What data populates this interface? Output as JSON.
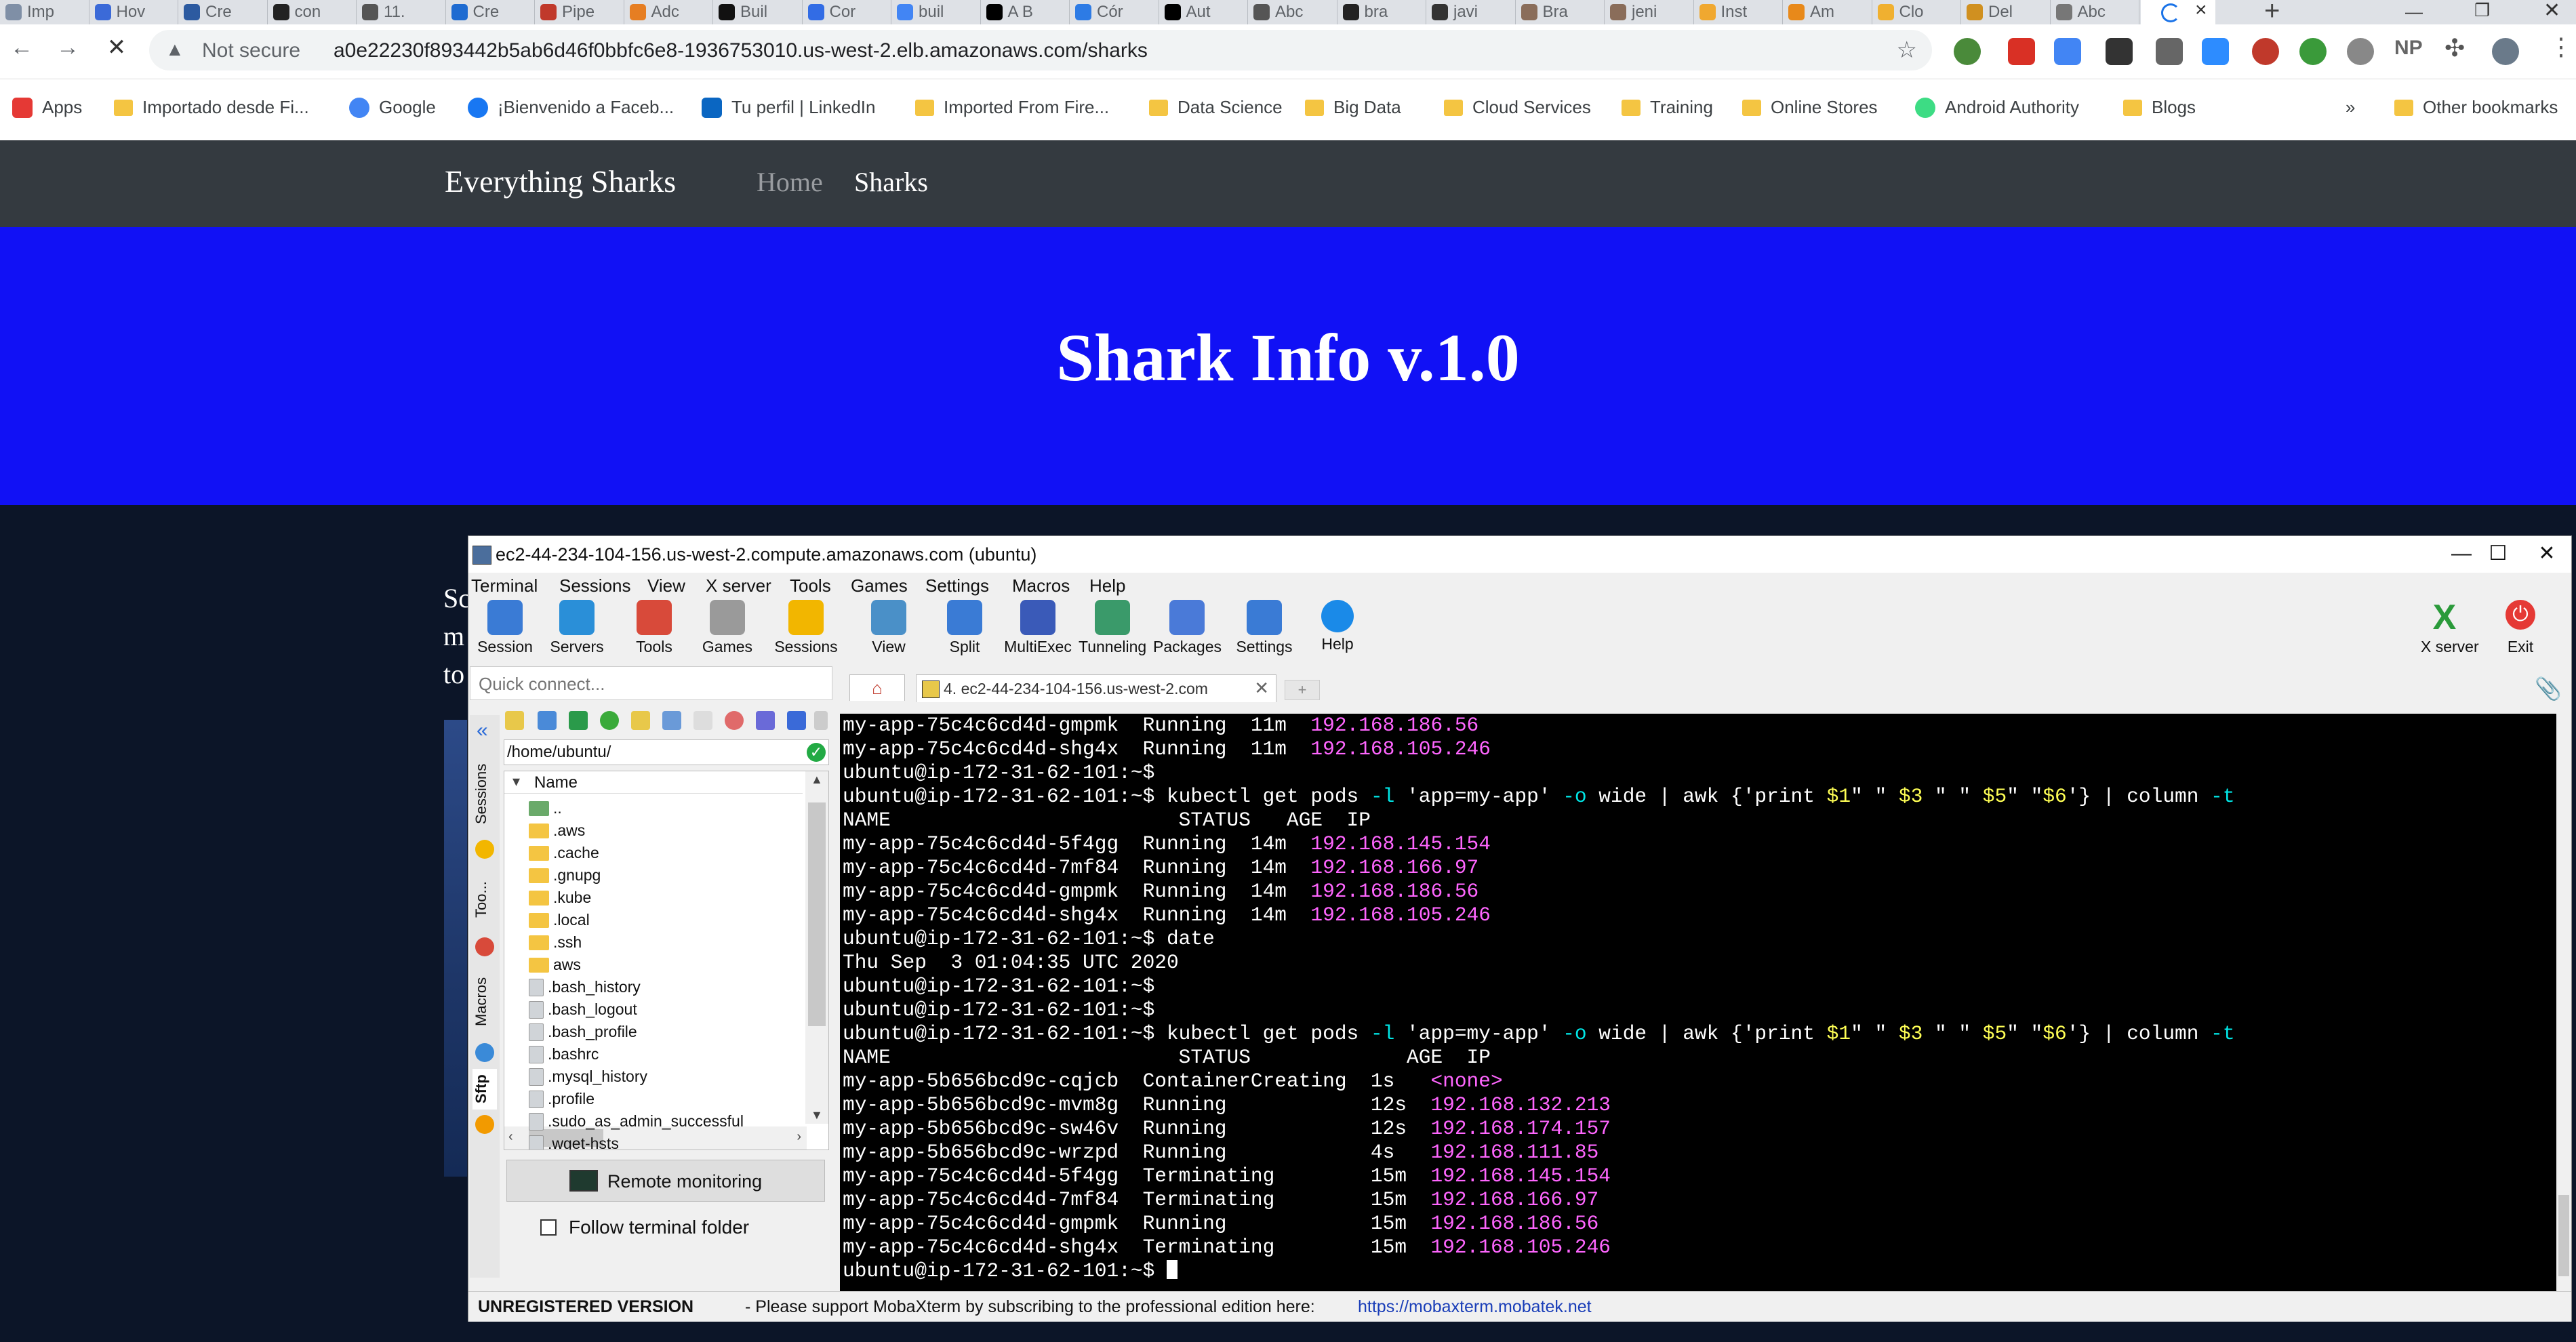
{
  "browser": {
    "tabs": [
      {
        "label": "Imp",
        "color": "#7f8fa6"
      },
      {
        "label": "Hov",
        "color": "#3b6ad8"
      },
      {
        "label": "Cre",
        "color": "#2c5aa0"
      },
      {
        "label": "con",
        "color": "#222222"
      },
      {
        "label": "11.",
        "color": "#555555"
      },
      {
        "label": "Cre",
        "color": "#1e6bd1"
      },
      {
        "label": "Pipe",
        "color": "#c0392b"
      },
      {
        "label": "Adc",
        "color": "#e67e22"
      },
      {
        "label": "Buil",
        "color": "#111111"
      },
      {
        "label": "Cor",
        "color": "#326ce5"
      },
      {
        "label": "buil",
        "color": "#4285f4"
      },
      {
        "label": "A B",
        "color": "#000000"
      },
      {
        "label": "Cór",
        "color": "#2d7be5"
      },
      {
        "label": "Aut",
        "color": "#000000"
      },
      {
        "label": "Abc",
        "color": "#555555"
      },
      {
        "label": "bra",
        "color": "#222222"
      },
      {
        "label": "javi",
        "color": "#333333"
      },
      {
        "label": "Bra",
        "color": "#8a6d5a"
      },
      {
        "label": "jeni",
        "color": "#8a6d5a"
      },
      {
        "label": "Inst",
        "color": "#f0a830"
      },
      {
        "label": "Am",
        "color": "#e8891a"
      },
      {
        "label": "Clo",
        "color": "#f0b030"
      },
      {
        "label": "Del",
        "color": "#d09020"
      },
      {
        "label": "Abc",
        "color": "#777777"
      }
    ],
    "new_tab": "+",
    "close_tab": "×",
    "nav": {
      "back": "←",
      "forward": "→",
      "stop": "✕"
    },
    "security_label": "Not secure",
    "url": "a0e22230f893442b5ab6d46f0bbfc6e8-1936753010.us-west-2.elb.amazonaws.com/sharks",
    "bookmarks": [
      {
        "label": "Apps",
        "kind": "apps"
      },
      {
        "label": "Importado desde Fi...",
        "kind": "folder"
      },
      {
        "label": "Google",
        "kind": "google"
      },
      {
        "label": "¡Bienvenido a Faceb...",
        "kind": "facebook"
      },
      {
        "label": "Tu perfil | LinkedIn",
        "kind": "linkedin"
      },
      {
        "label": "Imported From Fire...",
        "kind": "folder"
      },
      {
        "label": "Data Science",
        "kind": "folder"
      },
      {
        "label": "Big Data",
        "kind": "folder"
      },
      {
        "label": "Cloud Services",
        "kind": "folder"
      },
      {
        "label": "Training",
        "kind": "folder"
      },
      {
        "label": "Online Stores",
        "kind": "folder"
      },
      {
        "label": "Android Authority",
        "kind": "android"
      },
      {
        "label": "Blogs",
        "kind": "folder"
      }
    ],
    "more_bookmarks": "»",
    "other_bookmarks": "Other bookmarks"
  },
  "site": {
    "brand": "Everything Sharks",
    "nav_home": "Home",
    "nav_sharks": "Sharks",
    "hero_title": "Shark Info v.1.0",
    "partial_text": [
      "Sc",
      "m",
      "to"
    ]
  },
  "moba": {
    "title": "ec2-44-234-104-156.us-west-2.compute.amazonaws.com (ubuntu)",
    "menu": [
      "Terminal",
      "Sessions",
      "View",
      "X server",
      "Tools",
      "Games",
      "Settings",
      "Macros",
      "Help"
    ],
    "toolbar": [
      {
        "label": "Session",
        "color": "#3a7bd5"
      },
      {
        "label": "Servers",
        "color": "#2a8fd8"
      },
      {
        "label": "Tools",
        "color": "#d84a3a"
      },
      {
        "label": "Games",
        "color": "#9a9a9a"
      },
      {
        "label": "Sessions",
        "color": "#f2b600"
      },
      {
        "label": "View",
        "color": "#4a90c8"
      },
      {
        "label": "Split",
        "color": "#3a7bd5"
      },
      {
        "label": "MultiExec",
        "color": "#3a5ab8"
      },
      {
        "label": "Tunneling",
        "color": "#3a9a6a"
      },
      {
        "label": "Packages",
        "color": "#4a7ad8"
      },
      {
        "label": "Settings",
        "color": "#3a7bd5"
      },
      {
        "label": "Help",
        "color": "#1a8ae8"
      }
    ],
    "xserver_label": "X server",
    "exit_label": "Exit",
    "quick_connect_placeholder": "Quick connect...",
    "vertical_tabs": [
      "Sessions",
      "Too...",
      "Macros",
      "Sftp"
    ],
    "path": "/home/ubuntu/",
    "tree_header": "Name",
    "files": [
      {
        "name": "..",
        "type": "up"
      },
      {
        "name": ".aws",
        "type": "folder"
      },
      {
        "name": ".cache",
        "type": "folder"
      },
      {
        "name": ".gnupg",
        "type": "folder"
      },
      {
        "name": ".kube",
        "type": "folder"
      },
      {
        "name": ".local",
        "type": "folder"
      },
      {
        "name": ".ssh",
        "type": "folder"
      },
      {
        "name": "aws",
        "type": "folder"
      },
      {
        "name": ".bash_history",
        "type": "file"
      },
      {
        "name": ".bash_logout",
        "type": "file"
      },
      {
        "name": ".bash_profile",
        "type": "file"
      },
      {
        "name": ".bashrc",
        "type": "file"
      },
      {
        "name": ".mysql_history",
        "type": "file"
      },
      {
        "name": ".profile",
        "type": "file"
      },
      {
        "name": ".sudo_as_admin_successful",
        "type": "file"
      },
      {
        "name": ".wget-hsts",
        "type": "file"
      }
    ],
    "remote_monitoring": "Remote monitoring",
    "follow_terminal_folder": "Follow terminal folder",
    "session_tab": "4. ec2-44-234-104-156.us-west-2.com",
    "status_unregistered": "UNREGISTERED VERSION",
    "status_message": "-  Please support MobaXterm by subscribing to the professional edition here:",
    "status_link": "https://mobaxterm.mobatek.net"
  },
  "terminal": {
    "prompt": "ubuntu@ip-172-31-62-101:~$",
    "cmd_get_pods": [
      "kubectl get pods ",
      "-l",
      " 'app=my-app' ",
      "-o",
      " wide | awk {'print ",
      "$1",
      "\" \" ",
      "$3",
      " \" \" ",
      "$5",
      "\" \"",
      "$6",
      "'} | column ",
      "-t"
    ],
    "cmd_date": "date",
    "date_output": "Thu Sep  3 01:04:35 UTC 2020",
    "header_a": "NAME                        STATUS   AGE  IP",
    "header_b": "NAME                        STATUS             AGE  IP",
    "early_rows": [
      {
        "text": "my-app-75c4c6cd4d-gmpmk  Running  11m  ",
        "ip": "192.168.186.56"
      },
      {
        "text": "my-app-75c4c6cd4d-shg4x  Running  11m  ",
        "ip": "192.168.105.246"
      }
    ],
    "rows_a": [
      {
        "text": "my-app-75c4c6cd4d-5f4gg  Running  14m  ",
        "ip": "192.168.145.154"
      },
      {
        "text": "my-app-75c4c6cd4d-7mf84  Running  14m  ",
        "ip": "192.168.166.97"
      },
      {
        "text": "my-app-75c4c6cd4d-gmpmk  Running  14m  ",
        "ip": "192.168.186.56"
      },
      {
        "text": "my-app-75c4c6cd4d-shg4x  Running  14m  ",
        "ip": "192.168.105.246"
      }
    ],
    "rows_b": [
      {
        "text": "my-app-5b656bcd9c-cqjcb  ContainerCreating  1s   ",
        "ip": "<none>"
      },
      {
        "text": "my-app-5b656bcd9c-mvm8g  Running            12s  ",
        "ip": "192.168.132.213"
      },
      {
        "text": "my-app-5b656bcd9c-sw46v  Running            12s  ",
        "ip": "192.168.174.157"
      },
      {
        "text": "my-app-5b656bcd9c-wrzpd  Running            4s   ",
        "ip": "192.168.111.85"
      },
      {
        "text": "my-app-75c4c6cd4d-5f4gg  Terminating        15m  ",
        "ip": "192.168.145.154"
      },
      {
        "text": "my-app-75c4c6cd4d-7mf84  Terminating        15m  ",
        "ip": "192.168.166.97"
      },
      {
        "text": "my-app-75c4c6cd4d-gmpmk  Running            15m  ",
        "ip": "192.168.186.56"
      },
      {
        "text": "my-app-75c4c6cd4d-shg4x  Terminating        15m  ",
        "ip": "192.168.105.246"
      }
    ]
  }
}
